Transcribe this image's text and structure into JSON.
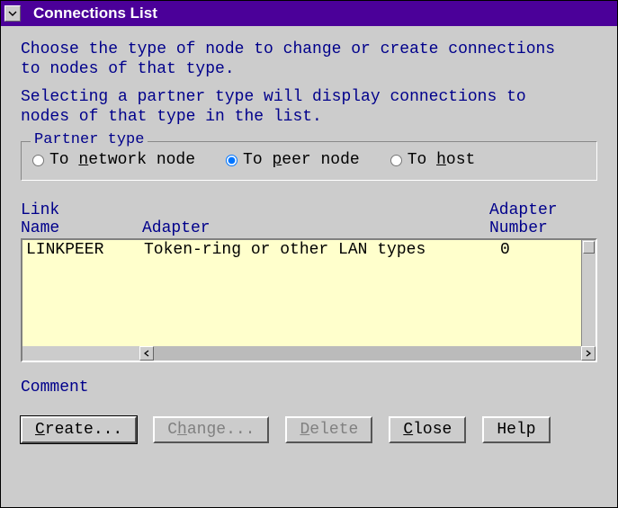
{
  "window": {
    "title": "Connections List"
  },
  "intro": {
    "line1": "Choose the type of node to change or create connections",
    "line2": "to nodes of that type.",
    "line3": "Selecting a partner type will display connections to",
    "line4": "nodes of that type in the list."
  },
  "partner_type": {
    "legend": "Partner type",
    "options": {
      "network": {
        "prefix": "To ",
        "letter": "n",
        "suffix": "etwork node",
        "selected": false
      },
      "peer": {
        "prefix": "To ",
        "letter": "p",
        "suffix": "eer node",
        "selected": true
      },
      "host": {
        "prefix": "To ",
        "letter": "h",
        "suffix": "ost",
        "selected": false
      }
    }
  },
  "columns": {
    "link_l1": "Link",
    "link_l2": "Name",
    "adapter_l1": "",
    "adapter_l2": "Adapter",
    "num_l1": "Adapter",
    "num_l2": "Number"
  },
  "rows": [
    {
      "link_name": "LINKPEER",
      "adapter": "Token-ring or other LAN types",
      "adapter_number": "0"
    }
  ],
  "comment_label": "Comment",
  "buttons": {
    "create": {
      "pre": "",
      "u": "C",
      "post": "reate...",
      "enabled": true,
      "default": true
    },
    "change": {
      "pre": "C",
      "u": "h",
      "post": "ange...",
      "enabled": false,
      "default": false
    },
    "delete": {
      "pre": "",
      "u": "D",
      "post": "elete",
      "enabled": false,
      "default": false
    },
    "close": {
      "pre": "",
      "u": "C",
      "post": "lose",
      "enabled": true,
      "default": false
    },
    "help": {
      "pre": "Help",
      "u": "",
      "post": "",
      "enabled": true,
      "default": false
    }
  }
}
